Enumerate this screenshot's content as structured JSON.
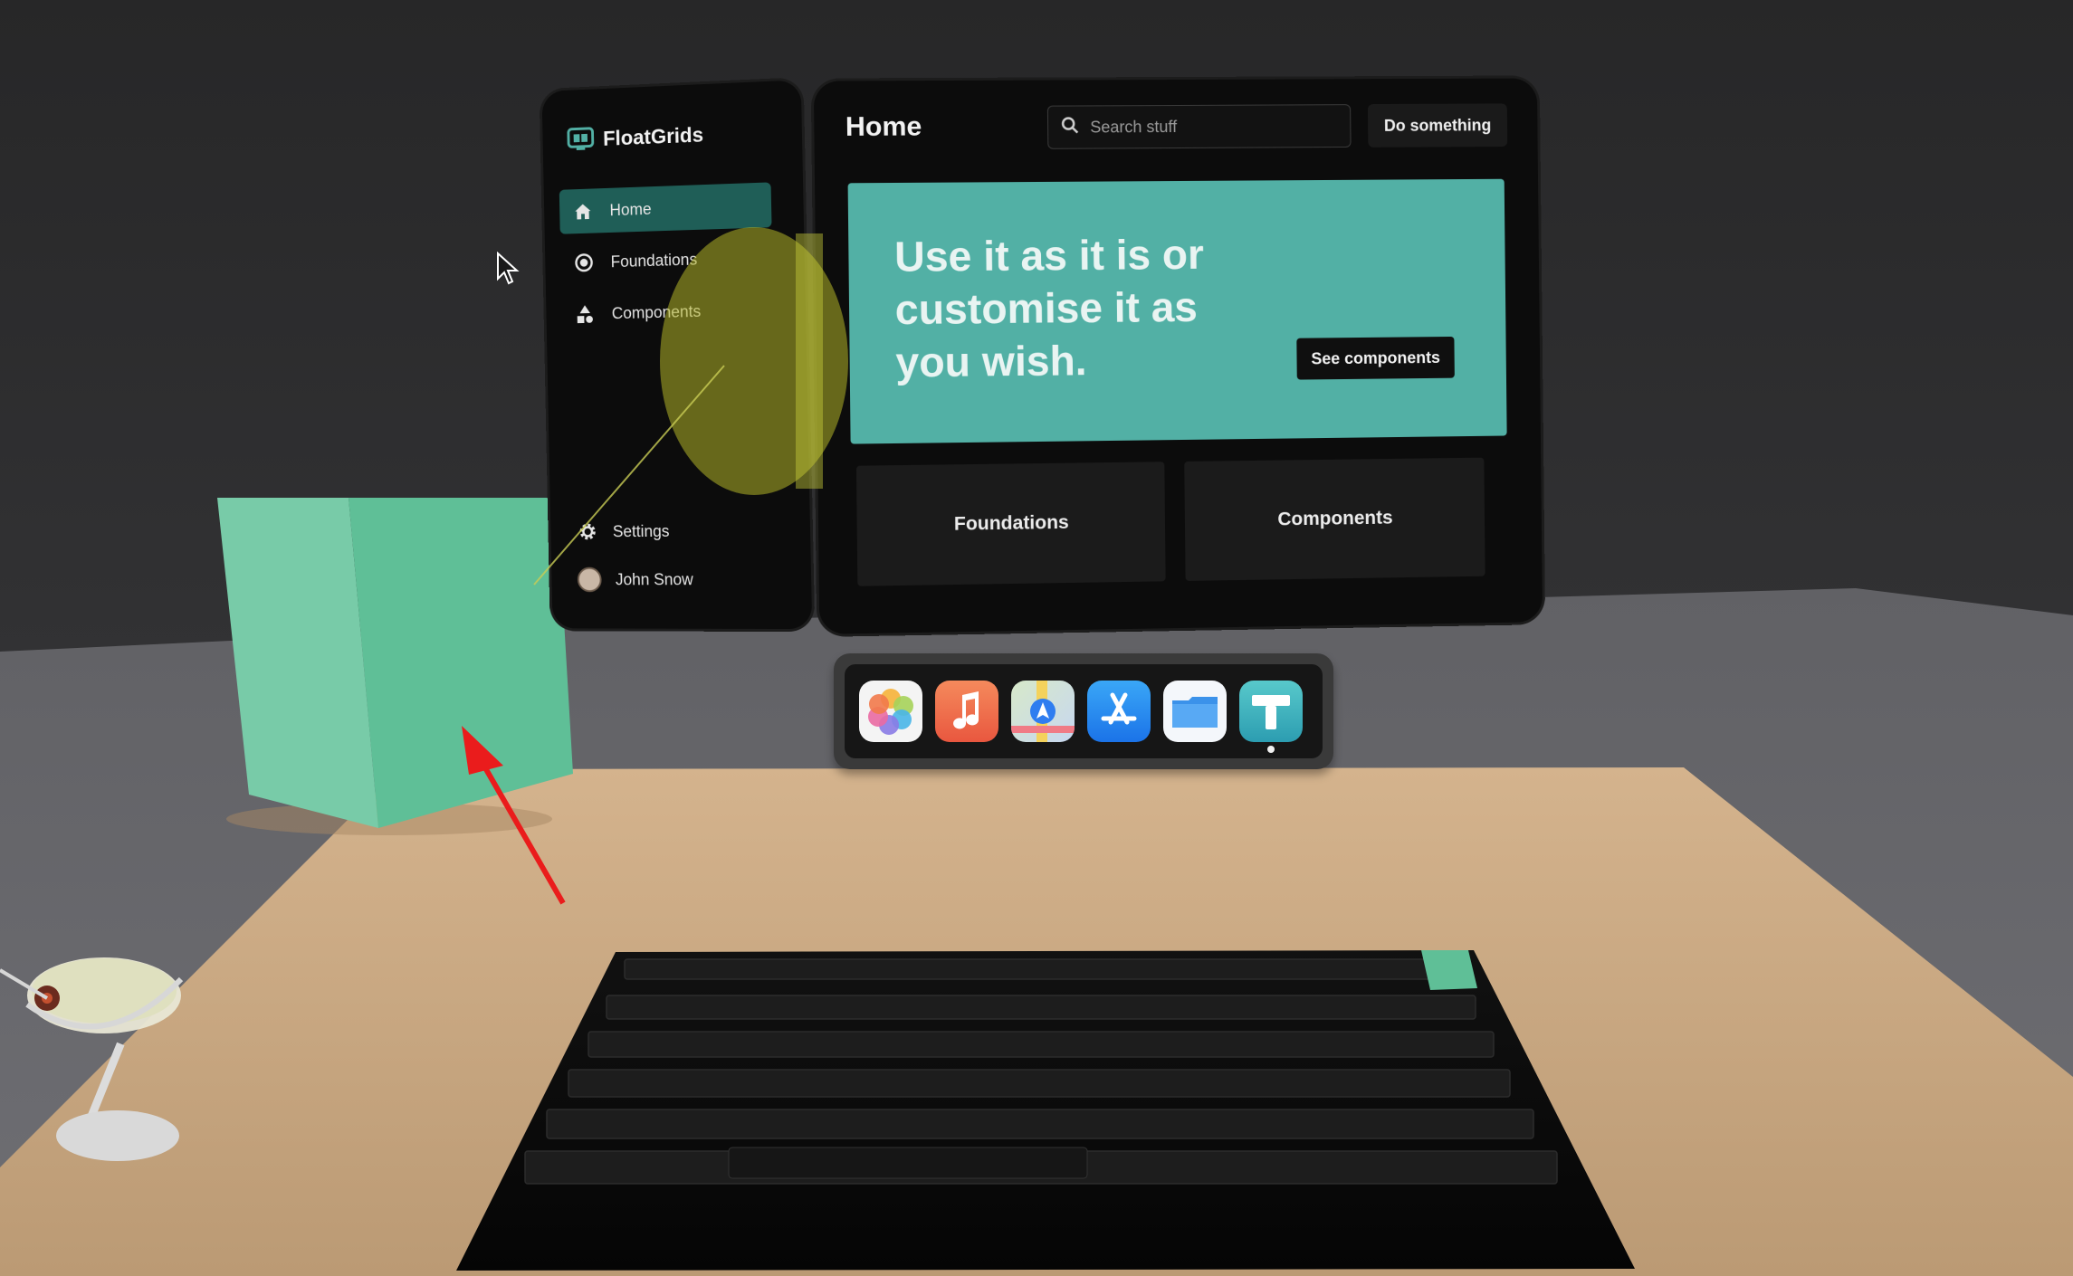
{
  "sidebar": {
    "brand": "FloatGrids",
    "items": [
      {
        "label": "Home",
        "icon": "home-icon"
      },
      {
        "label": "Foundations",
        "icon": "radio-icon"
      },
      {
        "label": "Components",
        "icon": "shapes-icon"
      }
    ],
    "settings_label": "Settings",
    "user_name": "John Snow"
  },
  "main": {
    "title": "Home",
    "search_placeholder": "Search stuff",
    "action_label": "Do something",
    "hero_text": "Use it as it is or customise it as you wish.",
    "hero_button": "See components",
    "cards": [
      "Foundations",
      "Components"
    ]
  },
  "dock": {
    "apps": [
      {
        "name": "photos-app-icon"
      },
      {
        "name": "music-app-icon"
      },
      {
        "name": "maps-app-icon"
      },
      {
        "name": "app-store-icon"
      },
      {
        "name": "files-app-icon"
      },
      {
        "name": "floatgrids-app-icon"
      }
    ]
  },
  "colors": {
    "accent": "#52b0a5",
    "active_nav": "#1f5e57",
    "cube": "#5fc39d",
    "table": "#caa77f"
  }
}
